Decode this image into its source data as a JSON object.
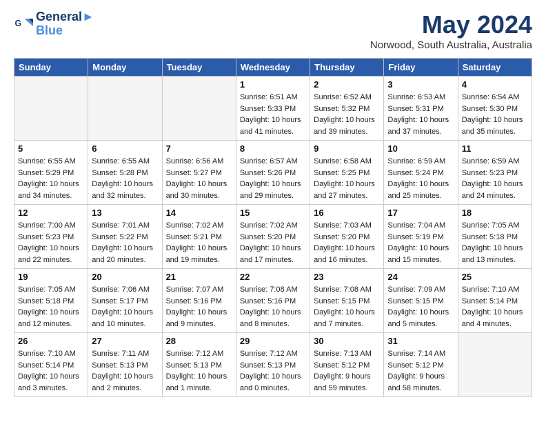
{
  "header": {
    "logo_line1": "General",
    "logo_line2": "Blue",
    "month": "May 2024",
    "location": "Norwood, South Australia, Australia"
  },
  "days_of_week": [
    "Sunday",
    "Monday",
    "Tuesday",
    "Wednesday",
    "Thursday",
    "Friday",
    "Saturday"
  ],
  "weeks": [
    [
      {
        "num": "",
        "info": ""
      },
      {
        "num": "",
        "info": ""
      },
      {
        "num": "",
        "info": ""
      },
      {
        "num": "1",
        "info": "Sunrise: 6:51 AM\nSunset: 5:33 PM\nDaylight: 10 hours\nand 41 minutes."
      },
      {
        "num": "2",
        "info": "Sunrise: 6:52 AM\nSunset: 5:32 PM\nDaylight: 10 hours\nand 39 minutes."
      },
      {
        "num": "3",
        "info": "Sunrise: 6:53 AM\nSunset: 5:31 PM\nDaylight: 10 hours\nand 37 minutes."
      },
      {
        "num": "4",
        "info": "Sunrise: 6:54 AM\nSunset: 5:30 PM\nDaylight: 10 hours\nand 35 minutes."
      }
    ],
    [
      {
        "num": "5",
        "info": "Sunrise: 6:55 AM\nSunset: 5:29 PM\nDaylight: 10 hours\nand 34 minutes."
      },
      {
        "num": "6",
        "info": "Sunrise: 6:55 AM\nSunset: 5:28 PM\nDaylight: 10 hours\nand 32 minutes."
      },
      {
        "num": "7",
        "info": "Sunrise: 6:56 AM\nSunset: 5:27 PM\nDaylight: 10 hours\nand 30 minutes."
      },
      {
        "num": "8",
        "info": "Sunrise: 6:57 AM\nSunset: 5:26 PM\nDaylight: 10 hours\nand 29 minutes."
      },
      {
        "num": "9",
        "info": "Sunrise: 6:58 AM\nSunset: 5:25 PM\nDaylight: 10 hours\nand 27 minutes."
      },
      {
        "num": "10",
        "info": "Sunrise: 6:59 AM\nSunset: 5:24 PM\nDaylight: 10 hours\nand 25 minutes."
      },
      {
        "num": "11",
        "info": "Sunrise: 6:59 AM\nSunset: 5:23 PM\nDaylight: 10 hours\nand 24 minutes."
      }
    ],
    [
      {
        "num": "12",
        "info": "Sunrise: 7:00 AM\nSunset: 5:23 PM\nDaylight: 10 hours\nand 22 minutes."
      },
      {
        "num": "13",
        "info": "Sunrise: 7:01 AM\nSunset: 5:22 PM\nDaylight: 10 hours\nand 20 minutes."
      },
      {
        "num": "14",
        "info": "Sunrise: 7:02 AM\nSunset: 5:21 PM\nDaylight: 10 hours\nand 19 minutes."
      },
      {
        "num": "15",
        "info": "Sunrise: 7:02 AM\nSunset: 5:20 PM\nDaylight: 10 hours\nand 17 minutes."
      },
      {
        "num": "16",
        "info": "Sunrise: 7:03 AM\nSunset: 5:20 PM\nDaylight: 10 hours\nand 16 minutes."
      },
      {
        "num": "17",
        "info": "Sunrise: 7:04 AM\nSunset: 5:19 PM\nDaylight: 10 hours\nand 15 minutes."
      },
      {
        "num": "18",
        "info": "Sunrise: 7:05 AM\nSunset: 5:18 PM\nDaylight: 10 hours\nand 13 minutes."
      }
    ],
    [
      {
        "num": "19",
        "info": "Sunrise: 7:05 AM\nSunset: 5:18 PM\nDaylight: 10 hours\nand 12 minutes."
      },
      {
        "num": "20",
        "info": "Sunrise: 7:06 AM\nSunset: 5:17 PM\nDaylight: 10 hours\nand 10 minutes."
      },
      {
        "num": "21",
        "info": "Sunrise: 7:07 AM\nSunset: 5:16 PM\nDaylight: 10 hours\nand 9 minutes."
      },
      {
        "num": "22",
        "info": "Sunrise: 7:08 AM\nSunset: 5:16 PM\nDaylight: 10 hours\nand 8 minutes."
      },
      {
        "num": "23",
        "info": "Sunrise: 7:08 AM\nSunset: 5:15 PM\nDaylight: 10 hours\nand 7 minutes."
      },
      {
        "num": "24",
        "info": "Sunrise: 7:09 AM\nSunset: 5:15 PM\nDaylight: 10 hours\nand 5 minutes."
      },
      {
        "num": "25",
        "info": "Sunrise: 7:10 AM\nSunset: 5:14 PM\nDaylight: 10 hours\nand 4 minutes."
      }
    ],
    [
      {
        "num": "26",
        "info": "Sunrise: 7:10 AM\nSunset: 5:14 PM\nDaylight: 10 hours\nand 3 minutes."
      },
      {
        "num": "27",
        "info": "Sunrise: 7:11 AM\nSunset: 5:13 PM\nDaylight: 10 hours\nand 2 minutes."
      },
      {
        "num": "28",
        "info": "Sunrise: 7:12 AM\nSunset: 5:13 PM\nDaylight: 10 hours\nand 1 minute."
      },
      {
        "num": "29",
        "info": "Sunrise: 7:12 AM\nSunset: 5:13 PM\nDaylight: 10 hours\nand 0 minutes."
      },
      {
        "num": "30",
        "info": "Sunrise: 7:13 AM\nSunset: 5:12 PM\nDaylight: 9 hours\nand 59 minutes."
      },
      {
        "num": "31",
        "info": "Sunrise: 7:14 AM\nSunset: 5:12 PM\nDaylight: 9 hours\nand 58 minutes."
      },
      {
        "num": "",
        "info": ""
      }
    ]
  ]
}
